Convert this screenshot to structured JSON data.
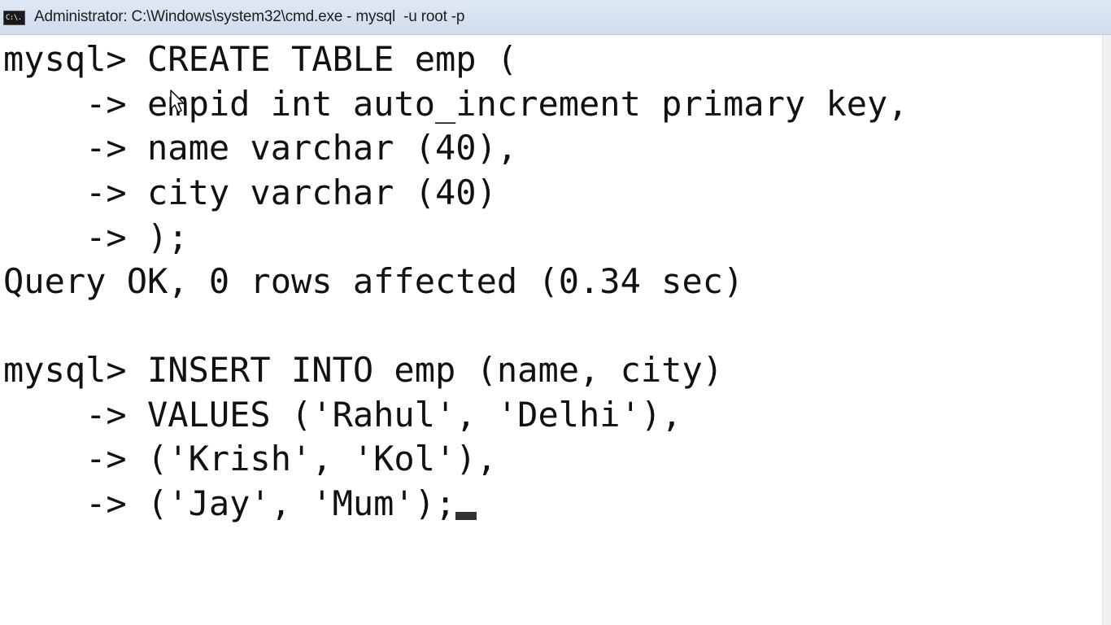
{
  "window": {
    "title": "Administrator: C:\\Windows\\system32\\cmd.exe - mysql  -u root -p",
    "icon_label": "C:\\."
  },
  "console": {
    "lines": [
      "mysql> CREATE TABLE emp (",
      "    -> empid int auto_increment primary key,",
      "    -> name varchar (40),",
      "    -> city varchar (40)",
      "    -> );",
      "Query OK, 0 rows affected (0.34 sec)",
      "",
      "mysql> INSERT INTO emp (name, city)",
      "    -> VALUES ('Rahul', 'Delhi'),",
      "    -> ('Krish', 'Kol'),",
      "    -> ('Jay', 'Mum');"
    ]
  },
  "icons": {
    "window_icon": "cmd-icon",
    "pointer": "mouse-pointer-icon"
  }
}
